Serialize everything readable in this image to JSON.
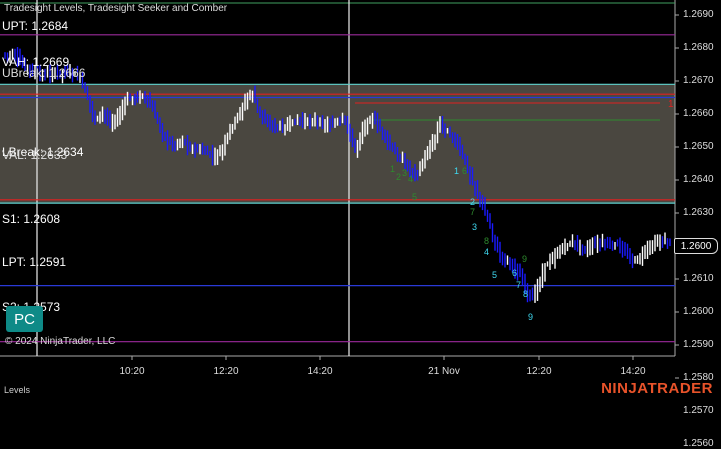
{
  "indicator_title": "Tradesight Levels, Tradesight Seeker and Comber",
  "levels": {
    "upt": "UPT: 1.2684",
    "vah": "VAH: 1.2669",
    "ubreak": "UBreak: 1.2666",
    "lbreak": "LBreak: 1.2634",
    "val": "VAL: 1.2633",
    "s1": "S1: 1.2608",
    "lpt": "LPT: 1.2591",
    "s2": "S2: 1.2573"
  },
  "price_axis": [
    "1.2690",
    "1.2680",
    "1.2670",
    "1.2660",
    "1.2650",
    "1.2640",
    "1.2630",
    "1.2620",
    "1.2610",
    "1.2600",
    "1.2590",
    "1.2580",
    "1.2570",
    "1.2560"
  ],
  "current_price": "1.2600",
  "time_axis": [
    "10:20",
    "12:20",
    "14:20",
    "21 Nov",
    "12:20",
    "14:20"
  ],
  "annotations": {
    "marker_one": "1",
    "red_level": "1.2634",
    "green_level": "1.2650"
  },
  "counts": {
    "cyan": [
      "1",
      "2",
      "3",
      "4",
      "5",
      "6",
      "7",
      "8",
      "9"
    ],
    "green": [
      "1",
      "2",
      "3",
      "4",
      "5",
      "6",
      "7",
      "8",
      "9"
    ]
  },
  "pc_button": "PC",
  "copyright": "© 2024 NinjaTrader, LLC",
  "panel_label": "Levels",
  "brand": "NINJATRADER",
  "colors": {
    "background": "#000000",
    "value_area": "#4a4740",
    "up_bar": "#ffffff",
    "down_bar": "#1a1aff",
    "level_purple": "#9b2a9b",
    "level_blue": "#2a3ad6",
    "level_red": "#e02020",
    "level_teal": "#5fd3cf",
    "count_cyan": "#3fd9f0",
    "count_green": "#2e8b2e",
    "brand": "#e8532a"
  }
}
